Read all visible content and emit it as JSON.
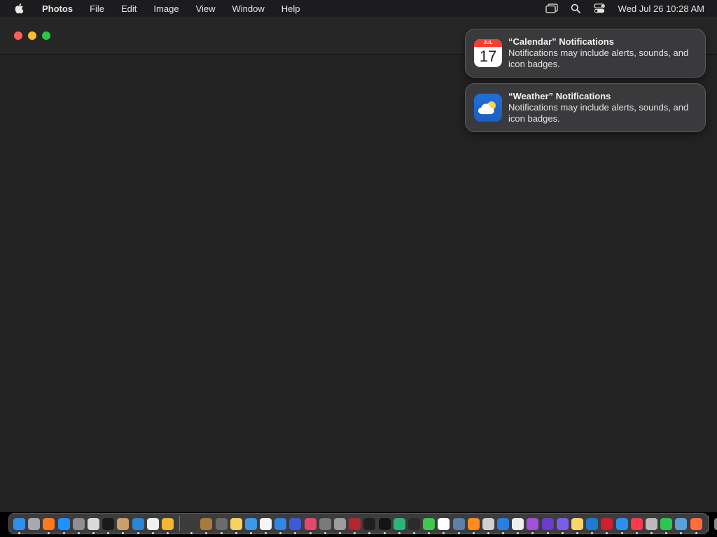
{
  "menubar": {
    "app_name": "Photos",
    "menus": [
      "File",
      "Edit",
      "Image",
      "View",
      "Window",
      "Help"
    ],
    "clock": "Wed Jul 26  10:28 AM",
    "status_icons": [
      "screen-mirroring-icon",
      "spotlight-search-icon",
      "control-center-icon"
    ]
  },
  "window": {
    "traffic_lights": [
      "close",
      "minimize",
      "zoom"
    ]
  },
  "notifications": [
    {
      "app": "calendar",
      "icon_month": "JUL",
      "icon_day": "17",
      "title": "“Calendar” Notifications",
      "body": "Notifications may include alerts, sounds, and icon badges."
    },
    {
      "app": "weather",
      "title": "“Weather” Notifications",
      "body": "Notifications may include alerts, sounds, and icon badges."
    }
  ],
  "dock": {
    "items": [
      {
        "name": "finder",
        "color": "#2f8fef",
        "running": true
      },
      {
        "name": "launchpad",
        "color": "#a8a8b0",
        "running": false
      },
      {
        "name": "firefox",
        "color": "#ff7a1a",
        "running": true
      },
      {
        "name": "app-store",
        "color": "#1e90ff",
        "running": true
      },
      {
        "name": "system-settings",
        "color": "#8e8e93",
        "running": true
      },
      {
        "name": "script-editor",
        "color": "#d9d9d9",
        "running": true
      },
      {
        "name": "terminal",
        "color": "#1a1a1a",
        "running": true
      },
      {
        "name": "brush-app",
        "color": "#c9a06a",
        "running": true
      },
      {
        "name": "vscode",
        "color": "#2b86d6",
        "running": true
      },
      {
        "name": "text-app",
        "color": "#f0f0f0",
        "running": true
      },
      {
        "name": "home",
        "color": "#f2b632",
        "running": true
      },
      {
        "name": "separator"
      },
      {
        "name": "pipette",
        "color": "#3a3a3a",
        "running": true
      },
      {
        "name": "notebook",
        "color": "#a77a3e",
        "running": true
      },
      {
        "name": "screenshot",
        "color": "#6b6b6b",
        "running": true
      },
      {
        "name": "notes",
        "color": "#f7d35c",
        "running": true
      },
      {
        "name": "cloud-app",
        "color": "#3a9ae8",
        "running": true
      },
      {
        "name": "reminders",
        "color": "#f5f5f5",
        "running": true
      },
      {
        "name": "safari",
        "color": "#2f86e5",
        "running": true
      },
      {
        "name": "stack-app",
        "color": "#3c5bd6",
        "running": true
      },
      {
        "name": "scribble",
        "color": "#e4496c",
        "running": true
      },
      {
        "name": "keyboard-app",
        "color": "#7a7a7a",
        "running": true
      },
      {
        "name": "checker-app",
        "color": "#9c9c9c",
        "running": true
      },
      {
        "name": "dictionary",
        "color": "#b3262f",
        "running": true
      },
      {
        "name": "stocks",
        "color": "#1f1f1f",
        "running": true
      },
      {
        "name": "apple-tv",
        "color": "#141414",
        "running": true
      },
      {
        "name": "find-my",
        "color": "#2bb673",
        "running": true
      },
      {
        "name": "voice-memos",
        "color": "#2b2b2b",
        "running": true
      },
      {
        "name": "messages",
        "color": "#3ec94a",
        "running": true
      },
      {
        "name": "calendar",
        "color": "#ffffff",
        "running": true
      },
      {
        "name": "preview",
        "color": "#5d7fa8",
        "running": true
      },
      {
        "name": "books",
        "color": "#ff8a1f",
        "running": true
      },
      {
        "name": "calculator",
        "color": "#d0d0d0",
        "running": true
      },
      {
        "name": "keynote",
        "color": "#2a7de1",
        "running": true
      },
      {
        "name": "clock",
        "color": "#efefef",
        "running": true
      },
      {
        "name": "podcasts",
        "color": "#a34fdc",
        "running": true
      },
      {
        "name": "visual-studio",
        "color": "#6b3cc9",
        "running": true
      },
      {
        "name": "chat-app",
        "color": "#7a5de8",
        "running": true
      },
      {
        "name": "files",
        "color": "#f7d56a",
        "running": true
      },
      {
        "name": "magnifier",
        "color": "#1e78d6",
        "running": true
      },
      {
        "name": "photo-booth",
        "color": "#d0202f",
        "running": true
      },
      {
        "name": "mail",
        "color": "#2d8ef0",
        "running": true
      },
      {
        "name": "music",
        "color": "#fa3a4c",
        "running": true
      },
      {
        "name": "utility",
        "color": "#bbbbbb",
        "running": true
      },
      {
        "name": "facetime",
        "color": "#2fc552",
        "running": true
      },
      {
        "name": "photo-editor",
        "color": "#5aa1d8",
        "running": true
      },
      {
        "name": "photos",
        "color": "#ff6d3a",
        "running": true
      },
      {
        "name": "separator"
      },
      {
        "name": "trash",
        "color": "#8a8a8a",
        "running": false
      }
    ]
  }
}
